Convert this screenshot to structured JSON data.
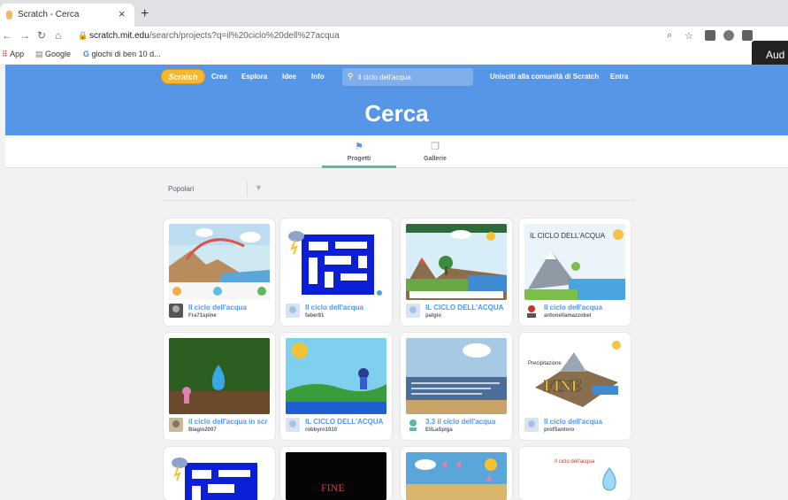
{
  "browser": {
    "tab_title": "Scratch - Cerca",
    "tab_close": "×",
    "new_tab": "+",
    "url_host": "scratch.mit.edu",
    "url_path": "/search/projects?q=il%20ciclo%20dell%27acqua",
    "bookmarks": [
      {
        "label": "App",
        "icon": "apps-grid-icon"
      },
      {
        "label": "Google",
        "icon": "folder-icon"
      },
      {
        "label": "giochi di ben 10 d...",
        "icon": "google-g-icon"
      }
    ],
    "tooltip_text": "Aud"
  },
  "scratch_nav": {
    "logo": "Scratch",
    "links": [
      "Crea",
      "Esplora",
      "Idee",
      "Info"
    ],
    "search_value": "il ciclo dell'acqua",
    "join": "Unisciti alla comunità di Scratch",
    "signin": "Entra"
  },
  "banner": {
    "title": "Cerca"
  },
  "subtabs": [
    {
      "label": "Progetti",
      "icon": "flag-icon",
      "active": true
    },
    {
      "label": "Gallerie",
      "icon": "gallery-icon",
      "active": false
    }
  ],
  "filter": {
    "value": "Popolari"
  },
  "projects": [
    {
      "title": "Il ciclo dell'acqua",
      "author": "Fra71spine"
    },
    {
      "title": "Il ciclo dell'acqua",
      "author": "faber91"
    },
    {
      "title": "IL CICLO DELL'ACQUA",
      "author": "patgio"
    },
    {
      "title": "Il ciclo dell'acqua",
      "author": "antonellamazzobel"
    },
    {
      "title": "il ciclo dell'acqua in scr",
      "author": "Biagio2007"
    },
    {
      "title": "IL CICLO DELL'ACQUA",
      "author": "robbyro1010"
    },
    {
      "title": "3.3 il ciclo dell'acqua",
      "author": "EliLaSpiga"
    },
    {
      "title": "Il ciclo dell'acqua",
      "author": "profSantoro"
    }
  ],
  "thumb_text": {
    "p4": "IL CICLO DELL'ACQUA",
    "p8_a": "Precipitazione",
    "p8_b": "FINE",
    "p10": "FINE",
    "p12": "Il ciclo dell'acqua"
  },
  "colors": {
    "scratch_blue": "#5596e6",
    "link_blue": "#4d97ff",
    "active_tab": "#5bb9aa"
  }
}
